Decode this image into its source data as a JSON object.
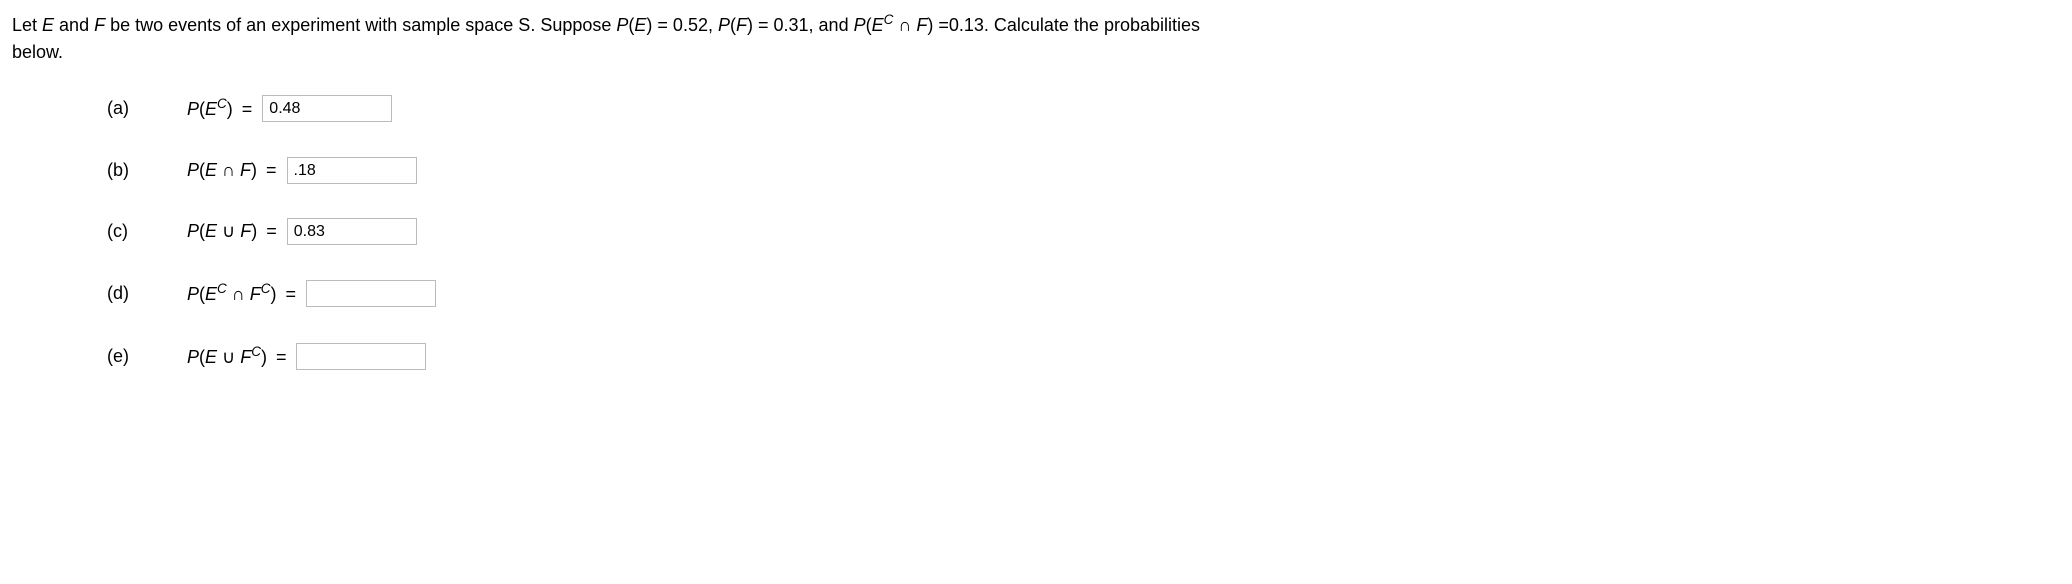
{
  "problem": {
    "intro_prefix": "Let ",
    "intro_E": "E",
    "intro_and": " and ",
    "intro_F": "F",
    "intro_mid1": " be two events of an experiment with sample space S. Suppose ",
    "pE_label": "P",
    "pE_var": "E",
    "pE_val": " = 0.52, ",
    "pF_label": "P",
    "pF_var": "F",
    "pF_val": " = 0.31, and ",
    "pEcF_label": "P",
    "pEcF_base": "E",
    "pEcF_sup": "C",
    "pEcF_inter": " ∩ ",
    "pEcF_F": "F",
    "pEcF_val": " =0.13. Calculate the probabilities",
    "below": "below."
  },
  "parts": {
    "a": {
      "label": "(a)",
      "input_value": "0.48"
    },
    "b": {
      "label": "(b)",
      "input_value": ".18"
    },
    "c": {
      "label": "(c)",
      "input_value": "0.83"
    },
    "d": {
      "label": "(d)",
      "input_value": ""
    },
    "e": {
      "label": "(e)",
      "input_value": ""
    }
  },
  "expr": {
    "P": "P",
    "open": "(",
    "close": ")",
    "E": "E",
    "F": "F",
    "C": "C",
    "eq": " = ",
    "inter": " ∩ ",
    "union": " ∪ "
  }
}
